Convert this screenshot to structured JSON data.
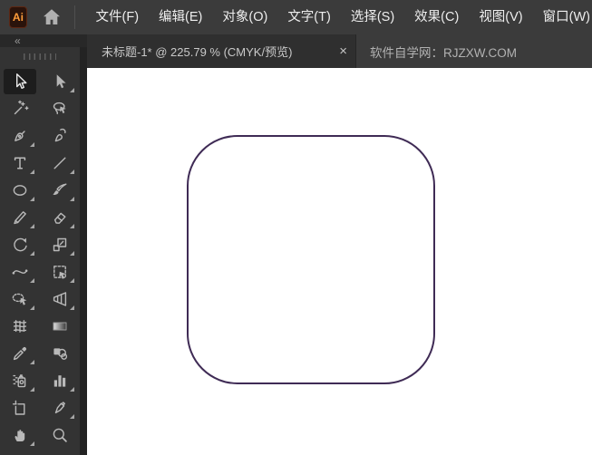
{
  "app": {
    "logo_text": "Ai",
    "icons": {
      "logo": "ai-logo",
      "home": "home-icon",
      "collapse": "chevrons-left-icon",
      "tab_close": "close-icon",
      "drag_handle": "drag-dots-icon"
    }
  },
  "menubar": {
    "items": [
      {
        "label": "文件(F)"
      },
      {
        "label": "编辑(E)"
      },
      {
        "label": "对象(O)"
      },
      {
        "label": "文字(T)"
      },
      {
        "label": "选择(S)"
      },
      {
        "label": "效果(C)"
      },
      {
        "label": "视图(V)"
      },
      {
        "label": "窗口(W)"
      }
    ]
  },
  "tabbar": {
    "active_tab": {
      "title": "未标题-1* @ 225.79 % (CMYK/预览)",
      "close_glyph": "×"
    },
    "watermark": "软件自学网：RJZXW.COM"
  },
  "toolbar": {
    "collapse_glyph": "«",
    "tools": [
      {
        "name": "selection-tool",
        "active": true,
        "flyout": false
      },
      {
        "name": "direct-selection-tool",
        "active": false,
        "flyout": true
      },
      {
        "name": "magic-wand-tool",
        "active": false,
        "flyout": false
      },
      {
        "name": "lasso-tool",
        "active": false,
        "flyout": false
      },
      {
        "name": "pen-tool",
        "active": false,
        "flyout": true
      },
      {
        "name": "curvature-tool",
        "active": false,
        "flyout": false
      },
      {
        "name": "type-tool",
        "active": false,
        "flyout": true
      },
      {
        "name": "line-segment-tool",
        "active": false,
        "flyout": true
      },
      {
        "name": "ellipse-tool",
        "active": false,
        "flyout": true
      },
      {
        "name": "paintbrush-tool",
        "active": false,
        "flyout": true
      },
      {
        "name": "shaper-tool",
        "active": false,
        "flyout": true
      },
      {
        "name": "eraser-tool",
        "active": false,
        "flyout": true
      },
      {
        "name": "rotate-tool",
        "active": false,
        "flyout": true
      },
      {
        "name": "scale-tool",
        "active": false,
        "flyout": true
      },
      {
        "name": "width-tool",
        "active": false,
        "flyout": true
      },
      {
        "name": "free-transform-tool",
        "active": false,
        "flyout": true
      },
      {
        "name": "shape-builder-tool",
        "active": false,
        "flyout": true
      },
      {
        "name": "perspective-grid-tool",
        "active": false,
        "flyout": true
      },
      {
        "name": "mesh-tool",
        "active": false,
        "flyout": false
      },
      {
        "name": "gradient-tool",
        "active": false,
        "flyout": false
      },
      {
        "name": "eyedropper-tool",
        "active": false,
        "flyout": true
      },
      {
        "name": "blend-tool",
        "active": false,
        "flyout": false
      },
      {
        "name": "symbol-sprayer-tool",
        "active": false,
        "flyout": true
      },
      {
        "name": "column-graph-tool",
        "active": false,
        "flyout": true
      },
      {
        "name": "artboard-tool",
        "active": false,
        "flyout": false
      },
      {
        "name": "slice-tool",
        "active": false,
        "flyout": true
      },
      {
        "name": "hand-tool",
        "active": false,
        "flyout": true
      },
      {
        "name": "zoom-tool",
        "active": false,
        "flyout": false
      }
    ]
  },
  "canvas": {
    "artboard_color": "#ffffff",
    "shape": {
      "type": "rounded-rectangle",
      "stroke_color": "#3f2b55",
      "fill": "none"
    }
  },
  "colors": {
    "menubar_bg": "#3b3b3b",
    "tab_bg": "#2f2f2f",
    "panel_bg": "#333333",
    "rail_bg": "#232323",
    "icon_gray": "#b9b9b9",
    "logo_orange": "#ff9d3a"
  }
}
